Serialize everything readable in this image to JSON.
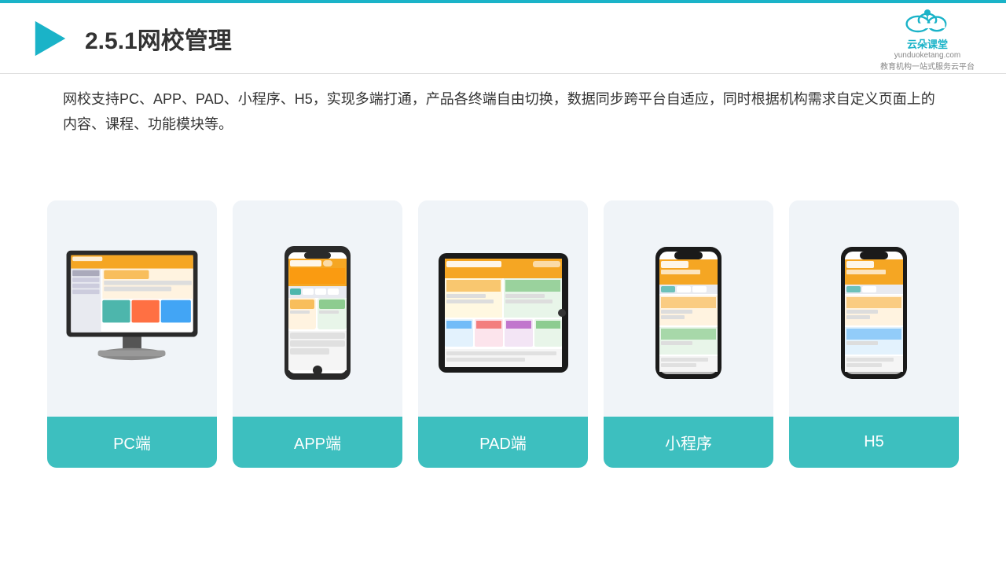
{
  "topLine": {
    "color": "#1ab3c8"
  },
  "header": {
    "title": "2.5.1网校管理",
    "brand": {
      "name": "云朵课堂",
      "url": "yunduoketang.com",
      "tagline": "教育机构一站\n式服务云平台"
    }
  },
  "description": {
    "text": "网校支持PC、APP、PAD、小程序、H5，实现多端打通，产品各终端自由切换，数据同步跨平台自适应，同时根据机构需求自定义页面上的内容、课程、功能模块等。"
  },
  "cards": [
    {
      "id": "pc",
      "label": "PC端"
    },
    {
      "id": "app",
      "label": "APP端"
    },
    {
      "id": "pad",
      "label": "PAD端"
    },
    {
      "id": "mini",
      "label": "小程序"
    },
    {
      "id": "h5",
      "label": "H5"
    }
  ],
  "colors": {
    "cardBg": "#eef2f7",
    "cardLabel": "#3dbfbf",
    "accent": "#1ab3c8"
  }
}
